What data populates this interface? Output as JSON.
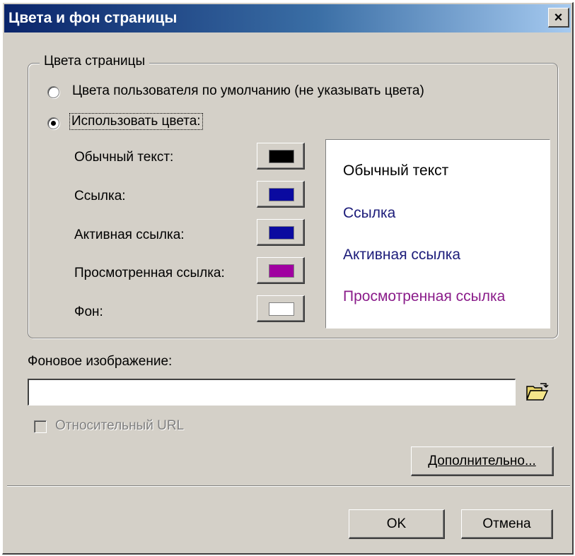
{
  "window": {
    "title": "Цвета и фон страницы",
    "close_label": "×"
  },
  "page_colors": {
    "group_title": "Цвета страницы",
    "option_default": "Цвета пользователя по умолчанию (не указывать цвета)",
    "option_custom": "Использовать цвета:",
    "selected_option": "custom",
    "rows": [
      {
        "label": "Обычный текст:",
        "color": "#000000"
      },
      {
        "label": "Ссылка:",
        "color": "#0a0aa0"
      },
      {
        "label": "Активная ссылка:",
        "color": "#0a0aa0"
      },
      {
        "label": "Просмотренная ссылка:",
        "color": "#a000a0"
      },
      {
        "label": "Фон:",
        "color": "#ffffff"
      }
    ]
  },
  "preview": {
    "normal_text": "Обычный текст",
    "link": "Ссылка",
    "active_link": "Активная ссылка",
    "visited_link": "Просмотренная ссылка",
    "colors": {
      "normal_text": "#000000",
      "link": "#1c1c7a",
      "active_link": "#1c1c7a",
      "visited_link": "#8a1c8a"
    }
  },
  "background_image": {
    "label": "Фоновое изображение:",
    "value": "",
    "relative_url_label": "Относительный URL",
    "relative_url_checked": false,
    "relative_url_enabled": false
  },
  "buttons": {
    "advanced": "Дополнительно...",
    "ok": "OK",
    "cancel": "Отмена"
  }
}
